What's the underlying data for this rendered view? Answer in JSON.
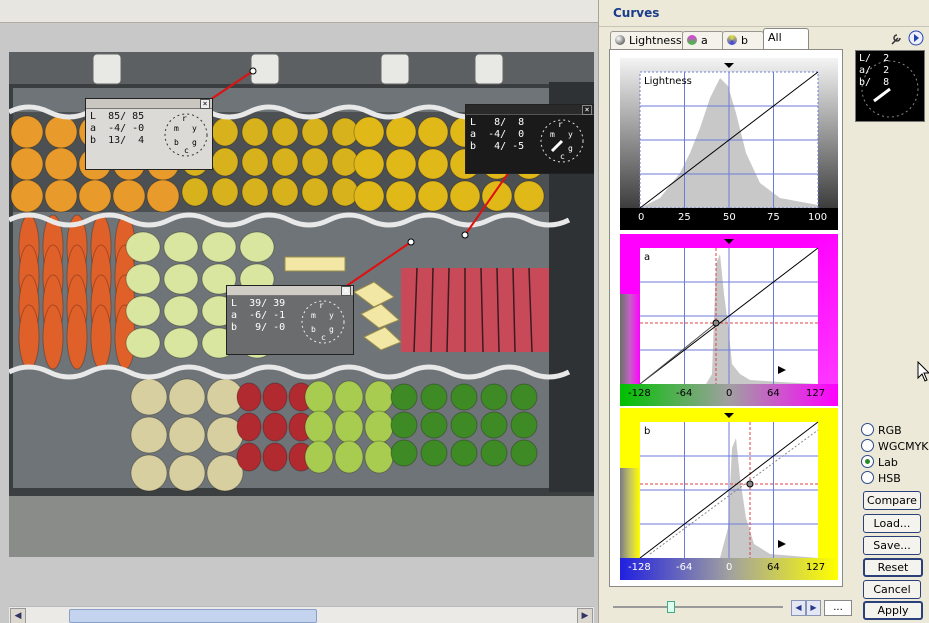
{
  "panel": {
    "title": "Curves",
    "tabs": [
      {
        "label": "Lightness",
        "icon": "lightness-icon"
      },
      {
        "label": "a",
        "icon": "a-channel-icon"
      },
      {
        "label": "b",
        "icon": "b-channel-icon"
      },
      {
        "label": "All",
        "active": true
      }
    ],
    "graphs": [
      {
        "name": "lightness",
        "label": "Lightness",
        "ticks": [
          "0",
          "25",
          "50",
          "75",
          "100"
        ]
      },
      {
        "name": "a",
        "label": "a",
        "ticks": [
          "-128",
          "-64",
          "0",
          "64",
          "127"
        ]
      },
      {
        "name": "b",
        "label": "b",
        "ticks": [
          "-128",
          "-64",
          "0",
          "64",
          "127"
        ]
      }
    ],
    "thumb_readout": {
      "L": "2",
      "a": "2",
      "b": "8"
    },
    "color_modes": [
      {
        "label": "RGB",
        "selected": false
      },
      {
        "label": "WGCMYK",
        "selected": false
      },
      {
        "label": "Lab",
        "selected": true
      },
      {
        "label": "HSB",
        "selected": false
      }
    ],
    "buttons": {
      "compare": "Compare",
      "load": "Load...",
      "save": "Save...",
      "reset": "Reset",
      "cancel": "Cancel",
      "apply": "Apply"
    },
    "more_label": "..."
  },
  "probes": [
    {
      "id": "p1",
      "theme": "light",
      "L": "85/ 85",
      "a": "-4/ -0",
      "b": "13/  4"
    },
    {
      "id": "p2",
      "theme": "dark",
      "L": " 8/  8",
      "a": "-4/  0",
      "b": " 4/ -5"
    },
    {
      "id": "p3",
      "theme": "grey",
      "L": "39/ 39",
      "a": "-6/ -1",
      "b": " 9/ -0"
    }
  ],
  "colors": {
    "accent": "#1a3c8c",
    "magenta": "#ff00ff",
    "yellow": "#ffff00",
    "probe_line": "#e01010"
  }
}
